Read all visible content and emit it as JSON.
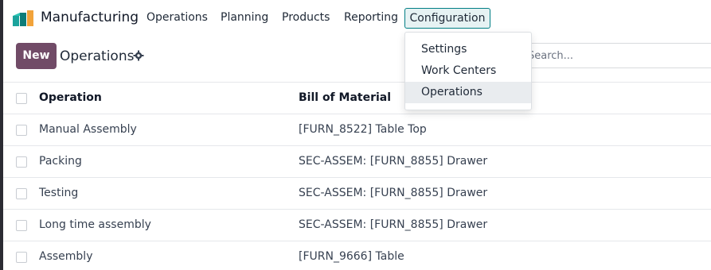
{
  "app": {
    "name": "Manufacturing"
  },
  "navbar": {
    "menus": [
      "Operations",
      "Planning",
      "Products",
      "Reporting"
    ],
    "config_label": "Configuration"
  },
  "control_panel": {
    "new_label": "New",
    "title": "Operations",
    "search_placeholder": "Search..."
  },
  "config_dropdown": {
    "items": [
      "Settings",
      "Work Centers",
      "Operations"
    ],
    "active_index": 2
  },
  "list": {
    "columns": [
      "Operation",
      "Bill of Material"
    ],
    "rows": [
      {
        "operation": "Manual Assembly",
        "bom": "[FURN_8522] Table Top"
      },
      {
        "operation": "Packing",
        "bom": "SEC-ASSEM: [FURN_8855] Drawer"
      },
      {
        "operation": "Testing",
        "bom": "SEC-ASSEM: [FURN_8855] Drawer"
      },
      {
        "operation": "Long time assembly",
        "bom": "SEC-ASSEM: [FURN_8855] Drawer"
      },
      {
        "operation": "Assembly",
        "bom": "[FURN_9666] Table"
      }
    ]
  },
  "colors": {
    "brand": "#714b67",
    "accent": "#017e84"
  },
  "icons": {
    "logo": "manufacturing-app-icon",
    "settings": "gear-icon"
  }
}
